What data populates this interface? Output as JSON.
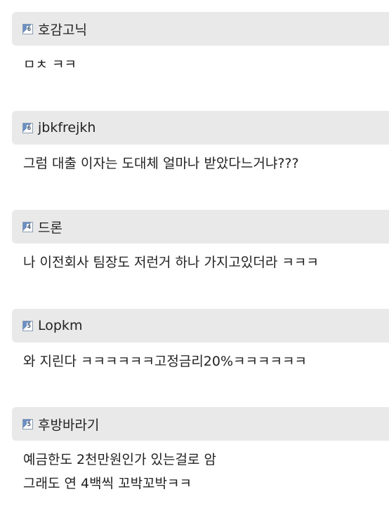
{
  "comments": [
    {
      "level": "6",
      "nickname": "호감고닉",
      "lines": [
        "ㅁㅊ ㅋㅋ"
      ]
    },
    {
      "level": "6",
      "nickname": "jbkfrejkh",
      "lines": [
        "그럼 대출 이자는 도대체 얼마나 받았다느거냐???"
      ]
    },
    {
      "level": "4",
      "nickname": "드론",
      "lines": [
        "나 이전회사 팀장도 저런거 하나 가지고있더라 ㅋㅋㅋ"
      ]
    },
    {
      "level": "5",
      "nickname": "Lopkm",
      "lines": [
        "와 지린다 ㅋㅋㅋㅋㅋㅋ고정금리20%ㅋㅋㅋㅋㅋㅋ"
      ]
    },
    {
      "level": "5",
      "nickname": "후방바라기",
      "lines": [
        "예금한도 2천만원인가 있는걸로 암",
        "그래도 연 4백씩 꼬박꼬박ㅋㅋ"
      ]
    }
  ]
}
